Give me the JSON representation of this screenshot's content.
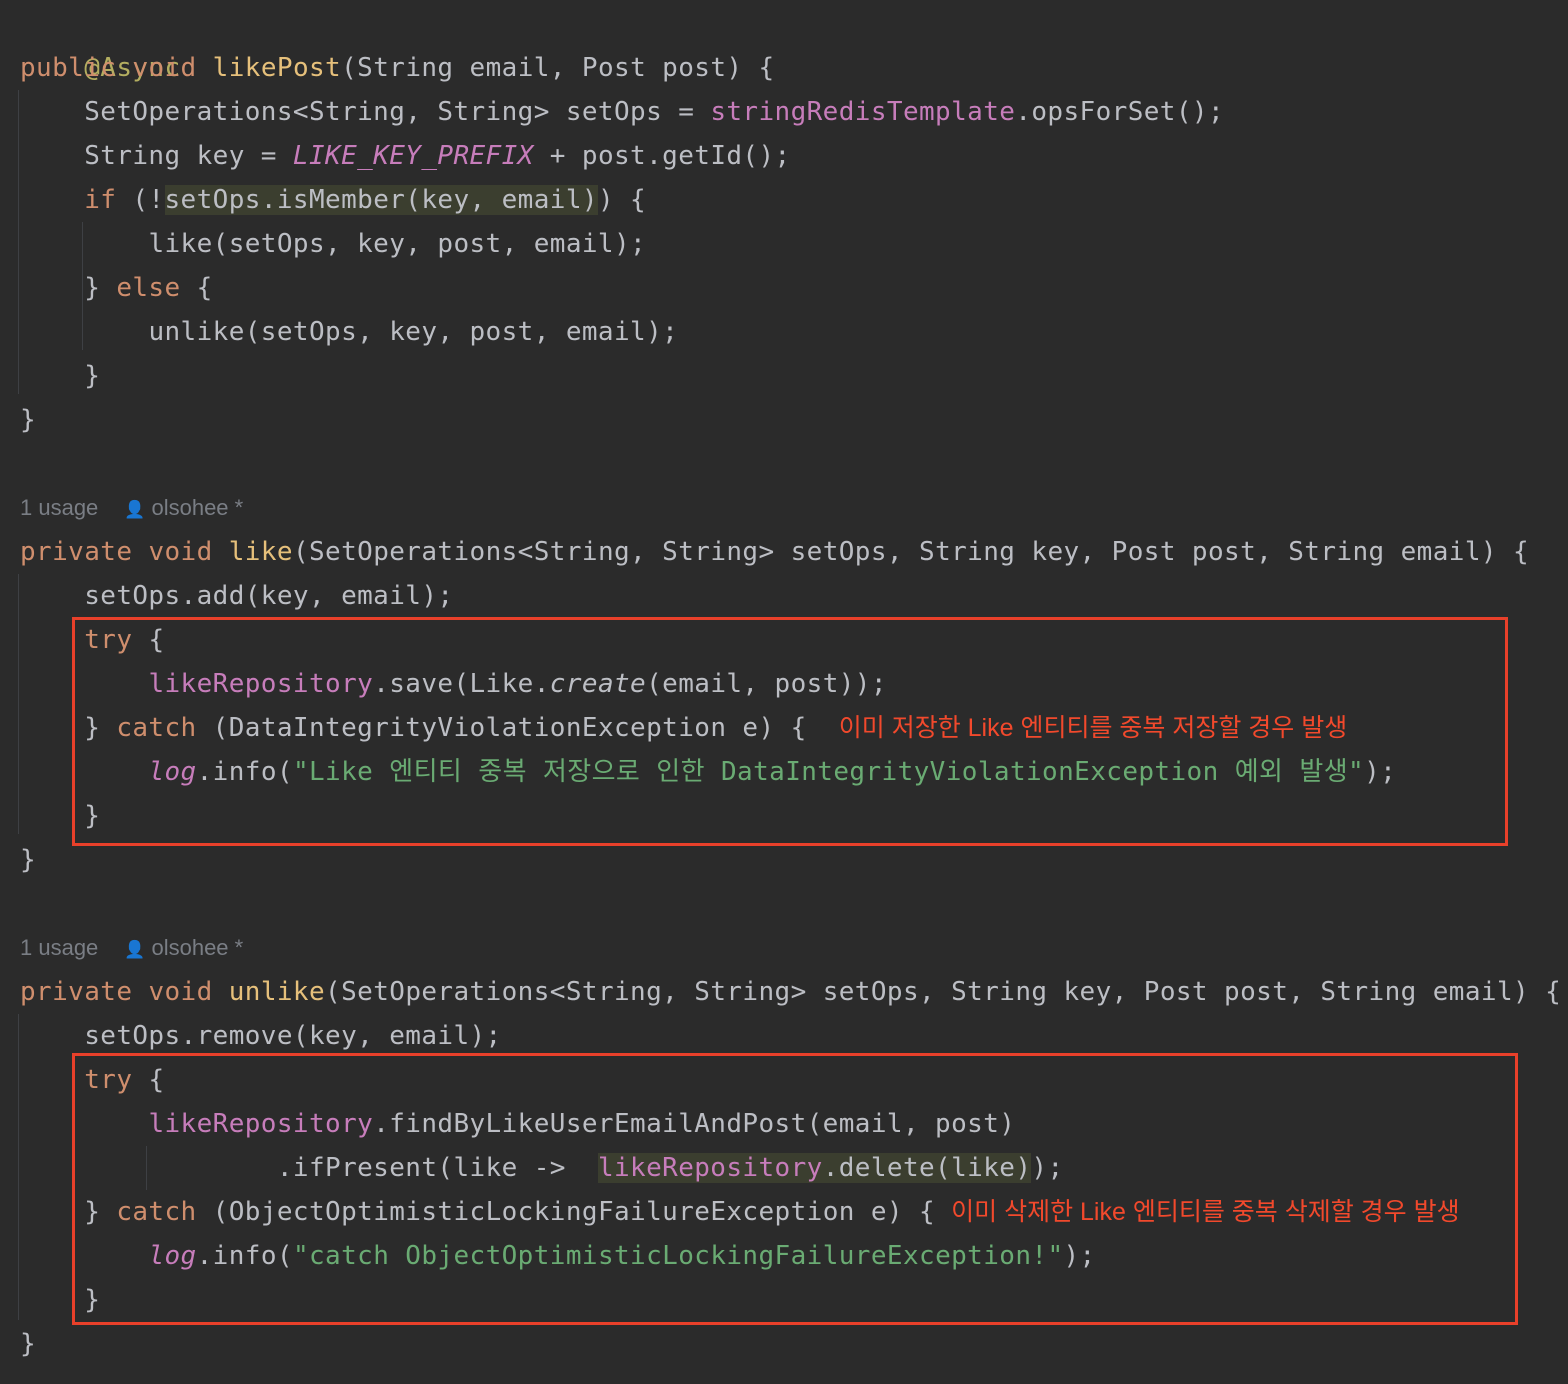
{
  "annotation": "@Async",
  "likePost": {
    "mod": "public",
    "ret": "void",
    "name": "likePost",
    "params": "(String email, Post post) {",
    "set_ops_decl": "SetOperations<String, String> setOps = ",
    "template_field": "stringRedisTemplate",
    "ops_call": ".opsForSet();",
    "key_decl": "String key = ",
    "key_const": "LIKE_KEY_PREFIX",
    "key_rest": " + post.getId();",
    "if_kw": "if",
    "if_open": " (!",
    "if_cond": "setOps.isMember(key, email)",
    "if_close": ") {",
    "like_call": "like(setOps, key, post, email);",
    "else_open": "} ",
    "else_kw": "else",
    "else_brace": " {",
    "unlike_call": "unlike(setOps, key, post, email);",
    "inner_close": "}",
    "outer_close": "}"
  },
  "like_meta": {
    "usage": "1 usage",
    "author": "olsohee *"
  },
  "like": {
    "mod": "private",
    "ret": "void",
    "name": "like",
    "params": "(SetOperations<String, String> setOps, String key, Post post, String email) {",
    "add_call": "setOps.add(key, email);",
    "try_kw": "try",
    "try_brace": " {",
    "repo_field": "likeRepository",
    "save_pre": ".save(Like.",
    "create_fn": "create",
    "save_post": "(email, post));",
    "catch_open": "} ",
    "catch_kw": "catch",
    "catch_rest": " (DataIntegrityViolationException e) {",
    "note": "이미 저장한 Like 엔티티를 중복 저장할 경우 발생",
    "log_field": "log",
    "log_pre": ".info(",
    "log_str": "\"Like 엔티티 중복 저장으로 인한 DataIntegrityViolationException 예외 발생\"",
    "log_post": ");",
    "inner_close": "}",
    "outer_close": "}"
  },
  "unlike_meta": {
    "usage": "1 usage",
    "author": "olsohee *"
  },
  "unlike": {
    "mod": "private",
    "ret": "void",
    "name": "unlike",
    "params": "(SetOperations<String, String> setOps, String key, Post post, String email) {",
    "remove_call": "setOps.remove(key, email);",
    "try_kw": "try",
    "try_brace": " {",
    "repo_field": "likeRepository",
    "find_call": ".findByLikeUserEmailAndPost(email, post)",
    "if_present": ".ifPresent(like -> ",
    "repo_field2": "likeRepository",
    "delete_call": ".delete(like)",
    "delete_end": ");",
    "catch_open": "} ",
    "catch_kw": "catch",
    "catch_rest": " (ObjectOptimisticLockingFailureException e) {",
    "note": "이미 삭제한 Like 엔티티를 중복 삭제할 경우 발생",
    "log_field": "log",
    "log_pre": ".info(",
    "log_str": "\"catch ObjectOptimisticLockingFailureException!\"",
    "log_post": ");",
    "inner_close": "}",
    "outer_close": "}"
  },
  "colors": {
    "background": "#2b2b2b",
    "keyword": "#cf8e6d",
    "method_name": "#e6c07b",
    "field": "#c77dbb",
    "string": "#6aab73",
    "annotation_box": "#e8402a",
    "annotation_text": "#f2492c"
  },
  "icons": {
    "author": "person-icon"
  }
}
